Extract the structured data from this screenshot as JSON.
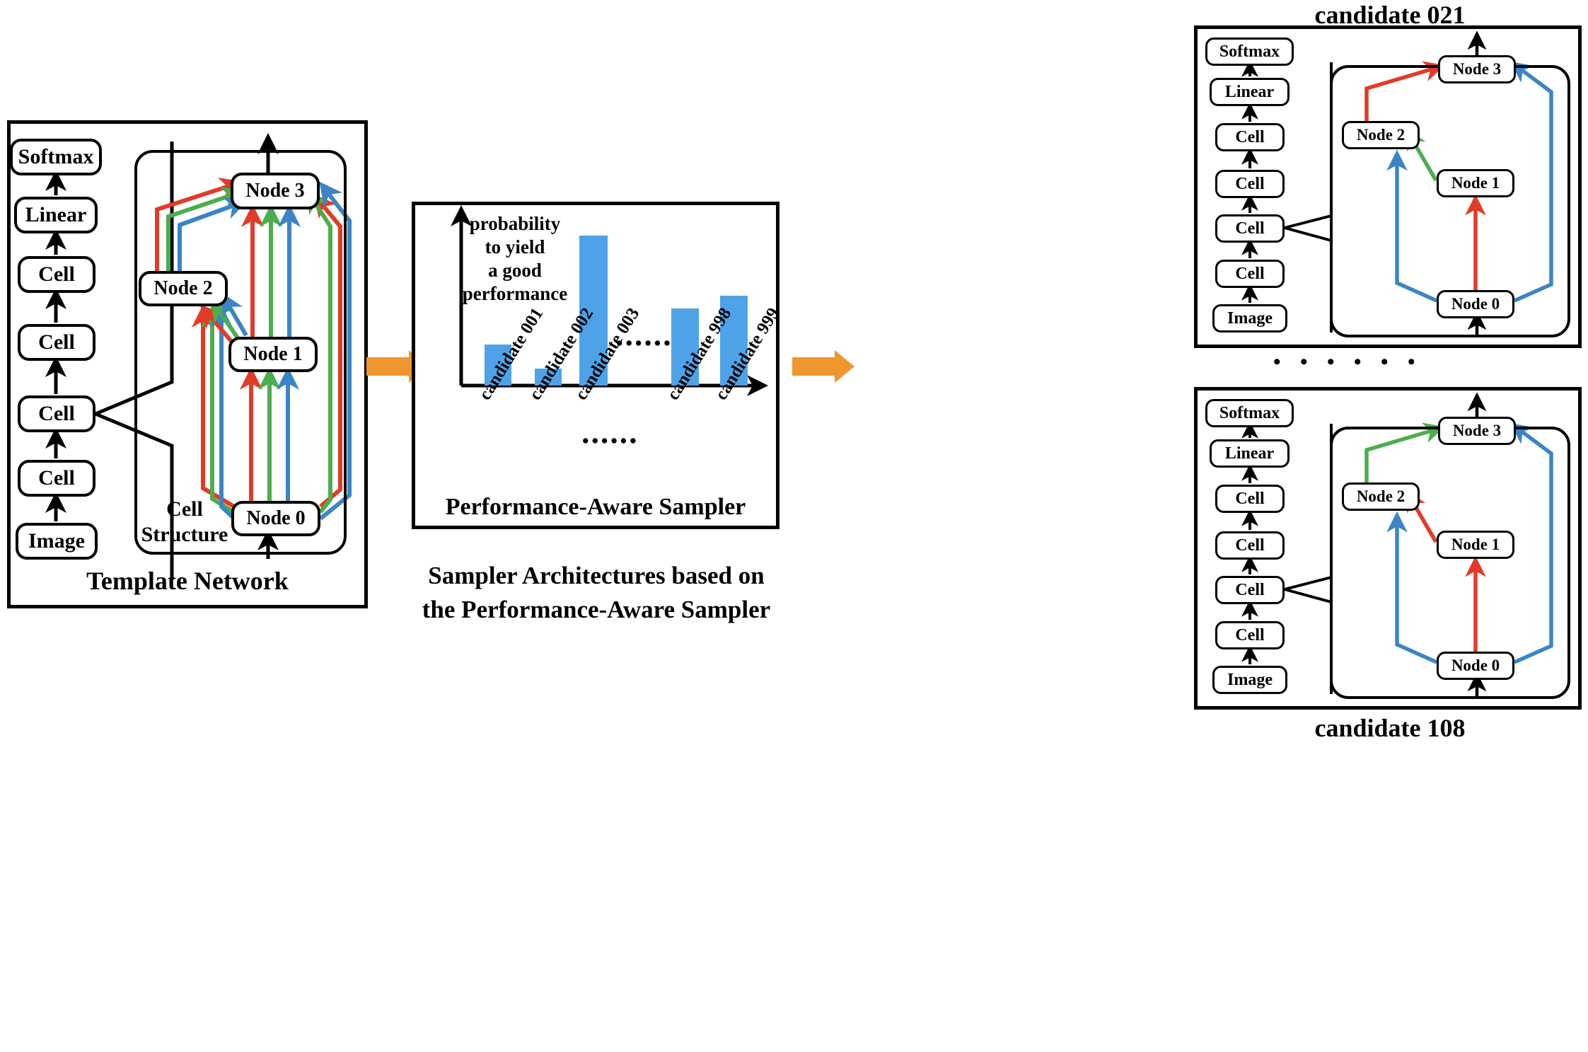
{
  "colors": {
    "red": "#e23b28",
    "green": "#4cae4c",
    "blue": "#3b85c6",
    "orange": "#f0962f",
    "bar_blue": "#4ea3e8",
    "black": "#000000"
  },
  "template_network": {
    "caption": "Template Network",
    "backbone": [
      "Softmax",
      "Linear",
      "Cell",
      "Cell",
      "Cell",
      "Cell",
      "Image"
    ],
    "cell_structure_label_line1": "Cell",
    "cell_structure_label_line2": "Structure",
    "nodes": [
      "Node 3",
      "Node 2",
      "Node 1",
      "Node 0"
    ],
    "edge_note": "every ordered node pair carries red, green and blue candidate operations"
  },
  "sampler": {
    "panel_title": "Performance-Aware Sampler",
    "caption_line1": "Sampler Architectures based on",
    "caption_line2": "the Performance-Aware Sampler",
    "ellipsis": "••••••"
  },
  "chart_data": {
    "type": "bar",
    "title": "Performance-Aware Sampler",
    "ylabel_lines": [
      "probability",
      "to yield",
      "a good",
      "performance"
    ],
    "xlabel": "",
    "categories": [
      "candidate 001",
      "candidate 002",
      "candidate 003",
      "candidate 998",
      "candidate 999"
    ],
    "values": [
      0.34,
      0.14,
      0.92,
      0.55,
      0.62
    ],
    "ylim": [
      0,
      1
    ],
    "gap_marker": "••••••",
    "grid": false,
    "legend": "none",
    "bar_color": "#4ea3e8"
  },
  "candidates": [
    {
      "title": "candidate 021",
      "title_position": "above",
      "backbone": [
        "Softmax",
        "Linear",
        "Cell",
        "Cell",
        "Cell",
        "Cell",
        "Image"
      ],
      "nodes": [
        "Node 3",
        "Node 2",
        "Node 1",
        "Node 0"
      ],
      "edges": [
        {
          "from": "Node 2",
          "to": "Node 3",
          "color": "red"
        },
        {
          "from": "Node 0",
          "to": "Node 3",
          "color": "blue"
        },
        {
          "from": "Node 1",
          "to": "Node 2",
          "color": "green"
        },
        {
          "from": "Node 0",
          "to": "Node 2",
          "color": "blue"
        },
        {
          "from": "Node 0",
          "to": "Node 1",
          "color": "red"
        }
      ]
    },
    {
      "title": "candidate 108",
      "title_position": "below",
      "backbone": [
        "Softmax",
        "Linear",
        "Cell",
        "Cell",
        "Cell",
        "Cell",
        "Image"
      ],
      "nodes": [
        "Node 3",
        "Node 2",
        "Node 1",
        "Node 0"
      ],
      "edges": [
        {
          "from": "Node 2",
          "to": "Node 3",
          "color": "green"
        },
        {
          "from": "Node 0",
          "to": "Node 3",
          "color": "blue"
        },
        {
          "from": "Node 1",
          "to": "Node 2",
          "color": "red"
        },
        {
          "from": "Node 0",
          "to": "Node 2",
          "color": "blue"
        },
        {
          "from": "Node 0",
          "to": "Node 1",
          "color": "red"
        }
      ]
    }
  ],
  "between_candidates_ellipsis": "• • • • • •"
}
